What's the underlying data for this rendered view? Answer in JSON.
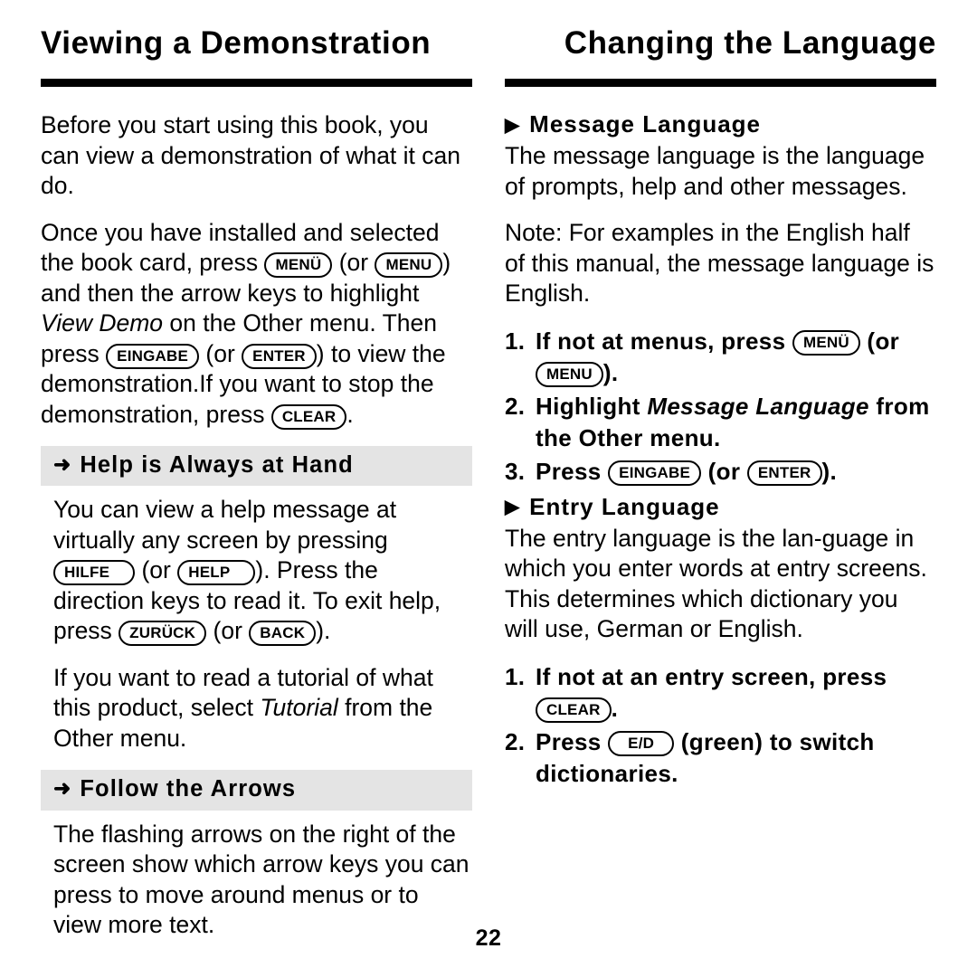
{
  "page": {
    "number": "22",
    "accent_color": "#000000",
    "band_color": "#e4e4e4"
  },
  "left_column": {
    "title": "Viewing a Demonstration",
    "intro_paragraph": "Before you start using this book, you can view a demonstration of what it can do.",
    "steps_paragraph": {
      "part1": "Once you have installed and selected the book card, press ",
      "key1": "MENÜ",
      "part2": " (or ",
      "key2": "MENU",
      "part3": ") and then the arrow keys to highlight ",
      "italic1": "View Demo",
      "part4": " on the Other menu. Then press ",
      "key3": "EINGABE",
      "part5": " (or ",
      "key4": "ENTER",
      "part6": ") to view the demonstration.If you want to stop the demonstration, press ",
      "key5": "CLEAR",
      "part7": "."
    },
    "sections": [
      {
        "marker": "right-arrow-marker",
        "marker_glyph": "➜",
        "heading": "Help is Always at Hand",
        "paragraph": {
          "part1": "You can view a help message at virtually any screen by pressing ",
          "key1": "HILFE",
          "part2": " (or ",
          "key2": "HELP",
          "part3": "). Press the direction keys to read it. To exit help, press ",
          "key3": "ZURÜCK",
          "part4": " (or ",
          "key4": "BACK",
          "part5": ")."
        },
        "paragraph2": {
          "part1": "If you want to read a tutorial of what this product, select ",
          "italic1": "Tutorial",
          "part2": " from the Other menu."
        }
      },
      {
        "marker": "right-arrow-marker",
        "marker_glyph": "➜",
        "heading": "Follow the Arrows",
        "paragraph": "The flashing arrows on the right of the screen show which arrow keys you can press to move around menus or to view more text."
      }
    ]
  },
  "right_column": {
    "title": "Changing the Language",
    "sections": [
      {
        "marker": "solid-triangle-marker",
        "marker_glyph": "▶",
        "heading": "Message Language",
        "paragraph1": "The message language is the language of prompts, help and other messages.",
        "paragraph2": "Note: For examples in the English half of this manual, the message language is English.",
        "steps": [
          {
            "num": "1.",
            "part1": "If not at menus, press ",
            "key1": "MENÜ",
            "part2": " (or ",
            "key2": "MENU",
            "part3": ")."
          },
          {
            "num": "2.",
            "part1": "Highlight ",
            "italic1": "Message Language",
            "part2": " from the Other menu."
          },
          {
            "num": "3.",
            "part1": "Press ",
            "key1": "EINGABE",
            "part2": " (or ",
            "key2": "ENTER",
            "part3": ")."
          }
        ]
      },
      {
        "marker": "solid-triangle-marker",
        "marker_glyph": "▶",
        "heading": "Entry Language",
        "paragraph1": "The entry language is the lan-guage in which you enter words at entry screens. This determines which dictionary you will use, German or English.",
        "steps": [
          {
            "num": "1.",
            "part1": "If not at an entry screen, press ",
            "key1": "CLEAR",
            "part2": "."
          },
          {
            "num": "2.",
            "part1": "Press ",
            "key1": "E/D",
            "part2": " (green) to switch dictionaries."
          }
        ]
      }
    ]
  }
}
